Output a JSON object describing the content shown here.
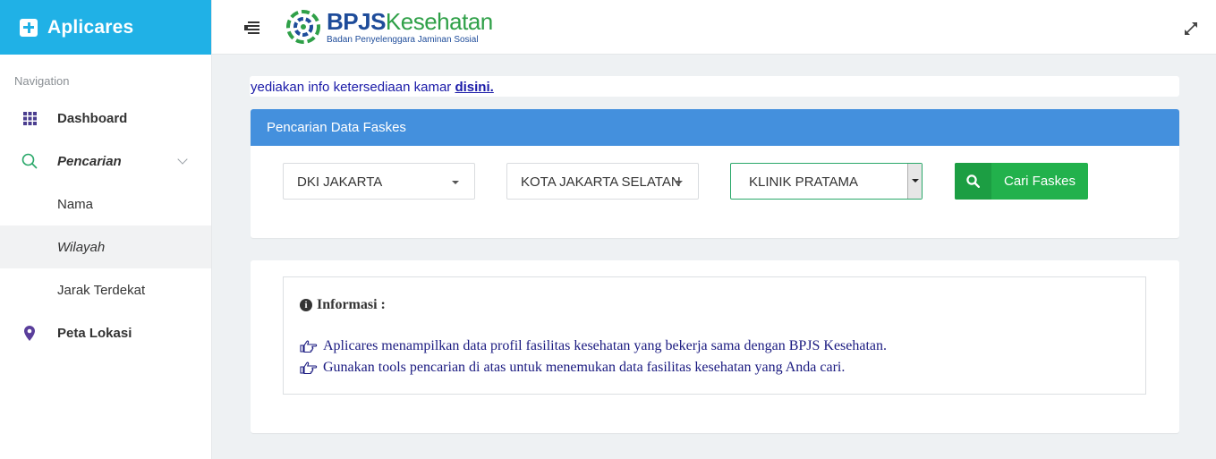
{
  "app": {
    "title": "Aplicares"
  },
  "sidebar": {
    "heading": "Navigation",
    "items": [
      {
        "label": "Dashboard",
        "icon": "grid-icon"
      },
      {
        "label": "Pencarian",
        "icon": "search-icon"
      },
      {
        "label": "Nama"
      },
      {
        "label": "Wilayah"
      },
      {
        "label": "Jarak Terdekat"
      },
      {
        "label": "Peta Lokasi",
        "icon": "map-marker-icon"
      }
    ]
  },
  "header": {
    "logo_bpjs": "BPJS",
    "logo_kesehatan": "Kesehatan",
    "logo_sub": "Badan Penyelenggara Jaminan Sosial"
  },
  "notice": {
    "text": "yediakan info ketersediaan kamar ",
    "link": "disini."
  },
  "search_panel": {
    "title": "Pencarian Data Faskes",
    "province": "DKI JAKARTA",
    "city": "KOTA JAKARTA SELATAN",
    "type": "KLINIK PRATAMA",
    "button": "Cari Faskes"
  },
  "info_panel": {
    "title": "Informasi :",
    "lines": [
      "Aplicares menampilkan data profil fasilitas kesehatan yang bekerja sama dengan BPJS Kesehatan.",
      "Gunakan tools pencarian di atas untuk menemukan data fasilitas kesehatan yang Anda cari."
    ]
  },
  "colors": {
    "brand": "#20b1e6",
    "panel_head": "#4490dd",
    "search_button": "#22b14c",
    "link": "#1a1aa8"
  }
}
